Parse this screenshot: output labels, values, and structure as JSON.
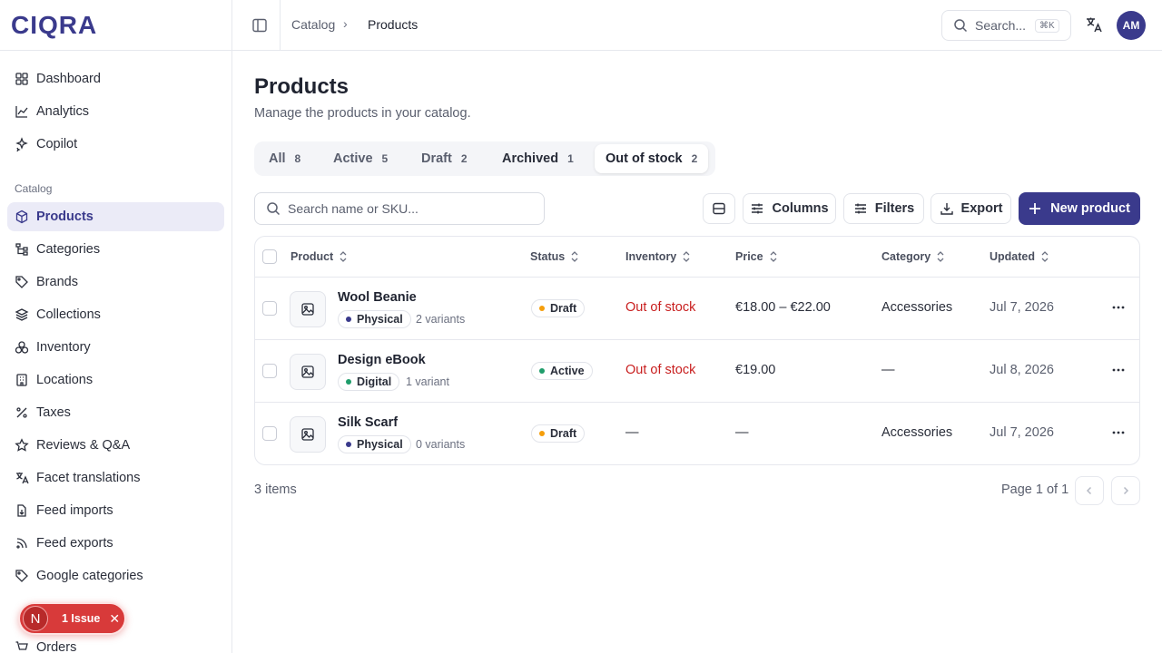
{
  "brand": {
    "logo": "CIQRA"
  },
  "sidebar": {
    "items": [
      {
        "label": "Dashboard",
        "icon": "dashboard-icon"
      },
      {
        "label": "Analytics",
        "icon": "chart-line-icon"
      },
      {
        "label": "Copilot",
        "icon": "sparkles-icon"
      }
    ],
    "catalog_label": "Catalog",
    "catalog_items": [
      {
        "label": "Products",
        "icon": "package-icon",
        "active": true
      },
      {
        "label": "Categories",
        "icon": "tree-icon"
      },
      {
        "label": "Brands",
        "icon": "tag-icon"
      },
      {
        "label": "Collections",
        "icon": "layers-icon"
      },
      {
        "label": "Inventory",
        "icon": "boxes-icon"
      },
      {
        "label": "Locations",
        "icon": "building-icon"
      },
      {
        "label": "Taxes",
        "icon": "percent-icon"
      },
      {
        "label": "Reviews & Q&A",
        "icon": "star-icon"
      },
      {
        "label": "Facet translations",
        "icon": "translate-icon"
      },
      {
        "label": "Feed imports",
        "icon": "file-import-icon"
      },
      {
        "label": "Feed exports",
        "icon": "rss-icon"
      },
      {
        "label": "Google categories",
        "icon": "tag-icon"
      }
    ],
    "partial_item": "Orders",
    "issue": {
      "letter": "N",
      "label": "1 Issue",
      "color": "#d83a3a"
    }
  },
  "topbar": {
    "breadcrumb": [
      "Catalog",
      "Products"
    ],
    "search_placeholder": "Search...",
    "search_shortcut": "⌘K",
    "avatar_initials": "AM"
  },
  "page": {
    "title": "Products",
    "subtitle": "Manage the products in your catalog."
  },
  "tabs": [
    {
      "label": "All",
      "count": "8"
    },
    {
      "label": "Active",
      "count": "5"
    },
    {
      "label": "Draft",
      "count": "2"
    },
    {
      "label": "Archived",
      "count": "1"
    },
    {
      "label": "Out of stock",
      "count": "2",
      "selected": true
    }
  ],
  "toolbar": {
    "search_placeholder": "Search name or SKU...",
    "columns_label": "Columns",
    "filters_label": "Filters",
    "export_label": "Export",
    "new_product_label": "New product"
  },
  "table": {
    "columns": [
      "Product",
      "Status",
      "Inventory",
      "Price",
      "Category",
      "Updated"
    ],
    "rows": [
      {
        "name": "Wool Beanie",
        "type": "Physical",
        "variants": "2 variants",
        "status": "Draft",
        "inventory": "Out of stock",
        "price": "€18.00 – €22.00",
        "category": "Accessories",
        "updated": "Jul 7, 2026"
      },
      {
        "name": "Design eBook",
        "type": "Digital",
        "variants": "1 variant",
        "status": "Active",
        "inventory": "Out of stock",
        "price": "€19.00",
        "category": "—",
        "updated": "Jul 8, 2026"
      },
      {
        "name": "Silk Scarf",
        "type": "Physical",
        "variants": "0 variants",
        "status": "Draft",
        "inventory": "—",
        "price": "—",
        "category": "Accessories",
        "updated": "Jul 7, 2026"
      }
    ]
  },
  "footer": {
    "items_count": "3 items",
    "page_info": "Page 1 of 1"
  },
  "colors": {
    "accent": "#3a3a8c",
    "physical_dot": "#3a3a8c",
    "digital_dot": "#1f9d6b",
    "draft_dot": "#f59e0b",
    "active_dot": "#1f9d6b",
    "danger": "#c81e1e"
  }
}
